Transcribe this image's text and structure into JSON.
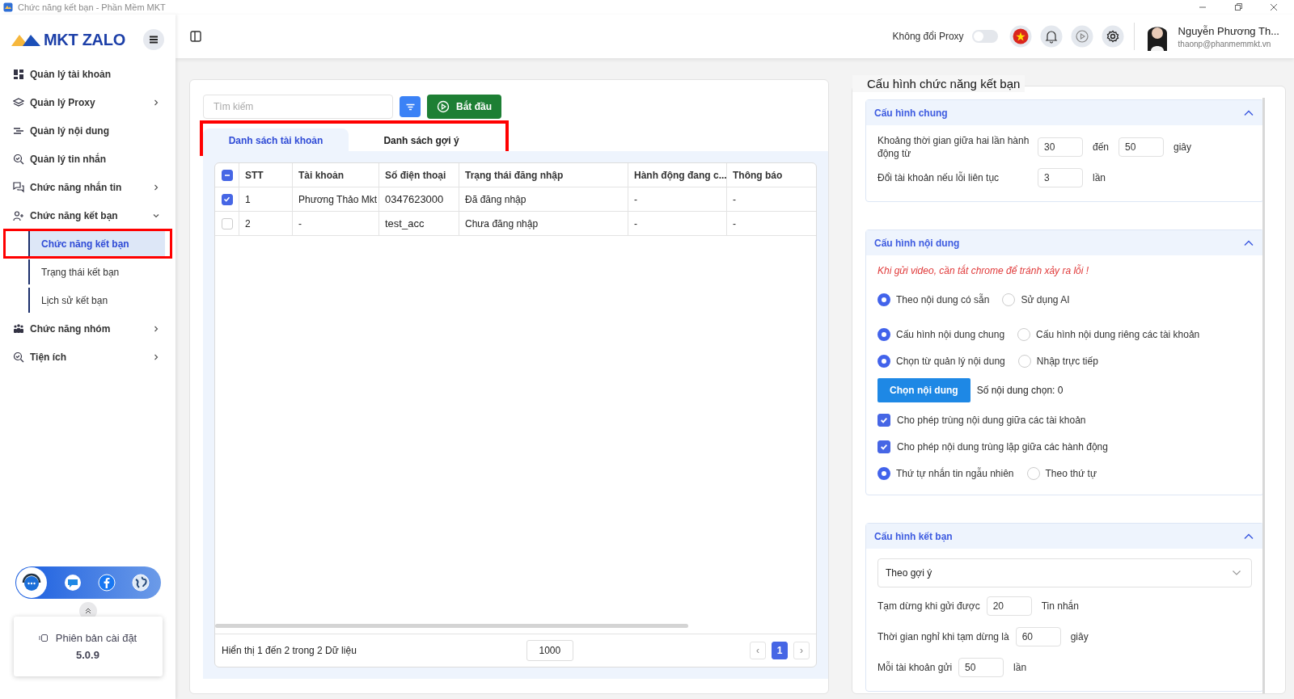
{
  "window": {
    "title": "Chức năng kết bạn - Phần Mềm MKT"
  },
  "sidebar": {
    "logo": "MKT ZALO",
    "items": [
      {
        "label": "Quản lý tài khoản"
      },
      {
        "label": "Quản lý Proxy",
        "expanded": false
      },
      {
        "label": "Quản lý nội dung"
      },
      {
        "label": "Quản lý tin nhắn"
      },
      {
        "label": "Chức năng nhắn tin",
        "expanded": false
      },
      {
        "label": "Chức năng kết bạn",
        "expanded": true,
        "children": [
          {
            "label": "Chức năng kết bạn",
            "selected": true,
            "highlighted": true
          },
          {
            "label": "Trạng thái kết bạn",
            "selected": false,
            "highlighted": false
          },
          {
            "label": "Lịch sử kết bạn",
            "selected": false,
            "highlighted": false
          }
        ]
      },
      {
        "label": "Chức năng nhóm",
        "expanded": false
      },
      {
        "label": "Tiện ích",
        "expanded": false
      }
    ],
    "version": {
      "label": "Phiên bản cài đặt",
      "number": "5.0.9"
    }
  },
  "header": {
    "proxy_label": "Không đổi Proxy",
    "proxy_on": false,
    "user": {
      "name": "Nguyễn Phương Th...",
      "email": "thaonp@phanmemmkt.vn"
    }
  },
  "toolbar": {
    "search_placeholder": "Tìm kiếm",
    "start_button": "Bắt đầu"
  },
  "tabs_highlighted": true,
  "tabs": [
    {
      "label": "Danh sách tài khoản",
      "selected": true
    },
    {
      "label": "Danh sách gợi ý",
      "selected": false
    }
  ],
  "table": {
    "select_all": {
      "indeterminate": true
    },
    "columns": [
      "STT",
      "Tài khoản",
      "Số điện thoại",
      "Trạng thái đăng nhập",
      "Hành động đang c...",
      "Thông báo"
    ],
    "rows": [
      {
        "checked": true,
        "cells": [
          "1",
          "Phương Thảo Mkt",
          "0347623000",
          "Đã đăng nhập",
          "-",
          "-"
        ]
      },
      {
        "checked": false,
        "cells": [
          "2",
          "-",
          "test_acc",
          "Chưa đăng nhập",
          "-",
          "-"
        ]
      }
    ]
  },
  "footer": {
    "summary": "Hiển thị 1 đến 2 trong 2 Dữ liệu",
    "page_size": "1000",
    "prev": "‹",
    "next": "›",
    "pages": [
      {
        "label": "1",
        "selected": true
      }
    ]
  },
  "config": {
    "title": "Cấu hình chức năng kết bạn",
    "sections": [
      {
        "title": "Cấu hình chung",
        "expanded": true,
        "rows": [
          {
            "kind": "range",
            "label": "Khoảng thời gian giữa hai lần hành động từ",
            "from": "30",
            "sep": "đến",
            "to": "50",
            "unit": "giây"
          },
          {
            "kind": "number",
            "label": "Đổi tài khoản nếu lỗi liên tục",
            "value": "3",
            "unit": "lần"
          }
        ]
      },
      {
        "title": "Cấu hình nội dung",
        "expanded": true,
        "rows": [
          {
            "kind": "warning",
            "text": "Khi gửi video, cần tắt chrome để tránh xảy ra lỗi !"
          },
          {
            "kind": "radio",
            "options": [
              {
                "label": "Theo nội dung có sẵn",
                "selected": true
              },
              {
                "label": "Sử dụng AI",
                "selected": false
              }
            ]
          },
          {
            "kind": "radio",
            "options": [
              {
                "label": "Cấu hình nội dung chung",
                "selected": true
              },
              {
                "label": "Cấu hình nội dung riêng các tài khoản",
                "selected": false
              }
            ]
          },
          {
            "kind": "radio",
            "options": [
              {
                "label": "Chọn từ quản lý nội dung",
                "selected": true
              },
              {
                "label": "Nhập trực tiếp",
                "selected": false
              }
            ]
          },
          {
            "kind": "button",
            "label": "Chọn nội dung",
            "note": "Số nội dung chọn: 0"
          },
          {
            "kind": "checkbox",
            "label": "Cho phép trùng nội dung giữa các tài khoản",
            "checked": true
          },
          {
            "kind": "checkbox",
            "label": "Cho phép nội dung trùng lặp giữa các hành động",
            "checked": true
          },
          {
            "kind": "radio",
            "options": [
              {
                "label": "Thứ tự nhắn tin ngẫu nhiên",
                "selected": true
              },
              {
                "label": "Theo thứ tự",
                "selected": false
              }
            ]
          }
        ]
      },
      {
        "title": "Cấu hình kết bạn",
        "expanded": true,
        "rows": [
          {
            "kind": "select",
            "value": "Theo gợi ý"
          },
          {
            "kind": "number",
            "label": "Tạm dừng khi gửi được",
            "value": "20",
            "unit": "Tin nhắn"
          },
          {
            "kind": "number",
            "label": "Thời gian nghỉ khi tạm dừng là",
            "value": "60",
            "unit": "giây"
          },
          {
            "kind": "number",
            "label": "Mỗi tài khoản gửi",
            "value": "50",
            "unit": "lần"
          }
        ]
      }
    ]
  }
}
